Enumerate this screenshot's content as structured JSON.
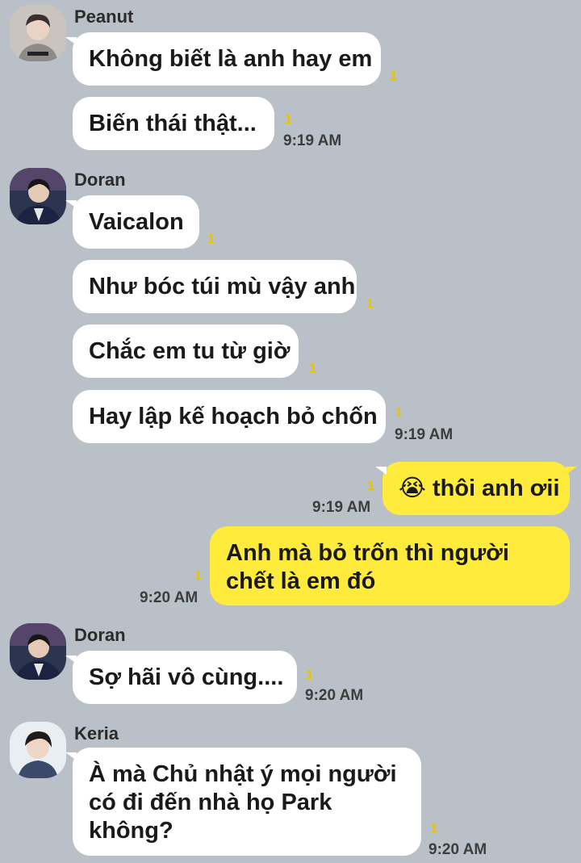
{
  "messages": [
    {
      "sender": "Peanut",
      "text": "Không biết là anh hay em",
      "read_count": "1"
    },
    {
      "text": "Biến thái thật...",
      "read_count": "1",
      "time": "9:19 AM"
    },
    {
      "sender": "Doran",
      "text": "Vaicalon",
      "read_count": "1"
    },
    {
      "text": "Như bóc túi mù vậy anh",
      "read_count": "1"
    },
    {
      "text": "Chắc em tu từ giờ",
      "read_count": "1"
    },
    {
      "text": "Hay lập kế hoạch bỏ chốn",
      "read_count": "1",
      "time": "9:19 AM"
    },
    {
      "outgoing": true,
      "emoji": "😭",
      "text": "thôi anh ơii",
      "read_count": "1",
      "time": "9:19 AM"
    },
    {
      "outgoing": true,
      "text": "Anh mà bỏ trốn thì người chết là em đó",
      "read_count": "1",
      "time": "9:20 AM"
    },
    {
      "sender": "Doran",
      "text": "Sợ hãi vô cùng....",
      "read_count": "1",
      "time": "9:20 AM"
    },
    {
      "sender": "Keria",
      "text": "À mà Chủ nhật ý mọi người có đi đến nhà họ Park không?",
      "read_count": "1",
      "time": "9:20 AM"
    }
  ],
  "colors": {
    "background": "#b9c0c7",
    "incoming_bubble": "#ffffff",
    "outgoing_bubble": "#ffeb3b",
    "unread_count": "#e8c300"
  }
}
